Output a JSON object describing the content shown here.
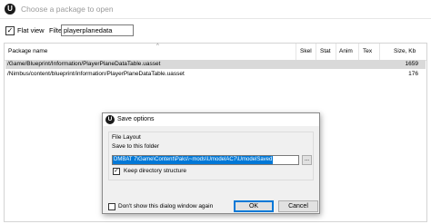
{
  "window": {
    "title": "Choose a package to open",
    "app_icon": "U"
  },
  "toolbar": {
    "flat_view_label": "Flat view",
    "flat_view_checked": "✓",
    "filter_label": "Filter",
    "filter_value": "playerplanedata"
  },
  "list": {
    "columns": {
      "name": "Package name",
      "skel": "Skel",
      "stat": "Stat",
      "anim": "Anim",
      "tex": "Tex",
      "size": "Size, Kb"
    },
    "rows": [
      {
        "path": "/Game/Blueprint/Information/PlayerPlaneDataTable.uasset",
        "size": "1659"
      },
      {
        "path": "/Nimbus/content/blueprint/information/PlayerPlaneDataTable.uasset",
        "size": "176"
      }
    ]
  },
  "dialog": {
    "title": "Save options",
    "icon": "U",
    "group_label": "File Layout",
    "folder_label": "Save to this folder",
    "folder_value": "DMBAT 7\\Game\\Content\\Paks\\~mods\\UmodelAC7\\UmodelSaved",
    "browse_label": "...",
    "keep_structure_label": "Keep directory structure",
    "keep_structure_checked": "✓",
    "dont_show_label": "Don't show this dialog window again",
    "ok_label": "OK",
    "cancel_label": "Cancel"
  }
}
